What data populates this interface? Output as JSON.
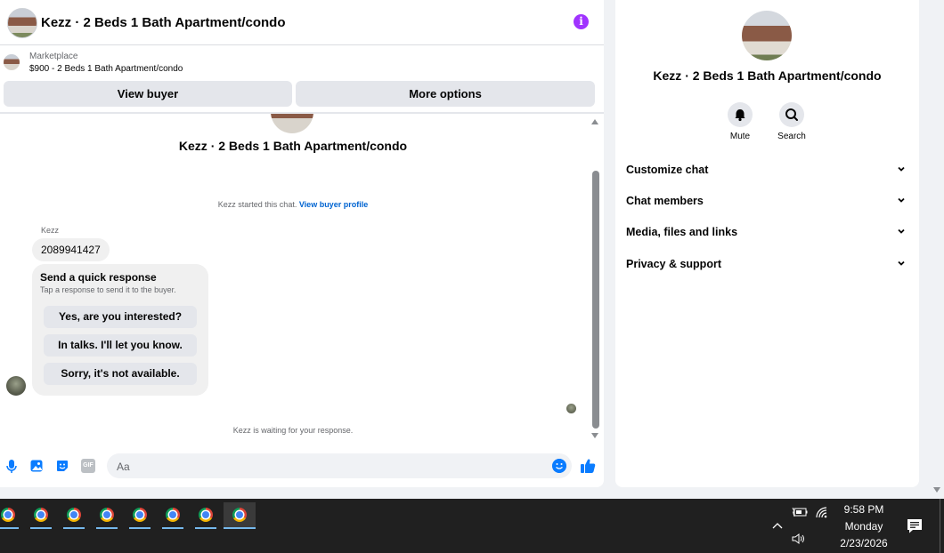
{
  "header": {
    "title": "Kezz · 2 Beds 1 Bath Apartment/condo",
    "info_icon": "info-icon"
  },
  "listing": {
    "kicker": "Marketplace",
    "price_line": "$900 - 2 Beds 1 Bath Apartment/condo"
  },
  "actions": {
    "view_buyer": "View buyer",
    "more_options": "More options"
  },
  "conversation": {
    "title": "Kezz · 2 Beds 1 Bath Apartment/condo",
    "started_text": "Kezz started this chat.",
    "started_link": "View buyer profile",
    "sender_name": "Kezz",
    "phone_message": "2089941427",
    "quick_title": "Send a quick response",
    "quick_subtitle": "Tap a response to send it to the buyer.",
    "quick_responses": [
      "Yes, are you interested?",
      "In talks. I'll let you know.",
      "Sorry, it's not available."
    ],
    "waiting_text": "Kezz is waiting for your response."
  },
  "composer": {
    "placeholder": "Aa",
    "icons": [
      "microphone-icon",
      "photo-icon",
      "sticker-icon",
      "gif-icon",
      "emoji-icon",
      "thumbs-up-icon"
    ],
    "gif_label": "GIF"
  },
  "side": {
    "title": "Kezz · 2 Beds 1 Bath Apartment/condo",
    "mute_label": "Mute",
    "search_label": "Search",
    "rows": [
      "Customize chat",
      "Chat members",
      "Media, files and links",
      "Privacy & support"
    ]
  },
  "taskbar": {
    "time": "9:58 PM",
    "day": "Monday",
    "date": "2/23/2026",
    "app_count": 8
  },
  "colors": {
    "accent": "#0a7cff",
    "info": "#a033ff",
    "link": "#0064d1"
  }
}
